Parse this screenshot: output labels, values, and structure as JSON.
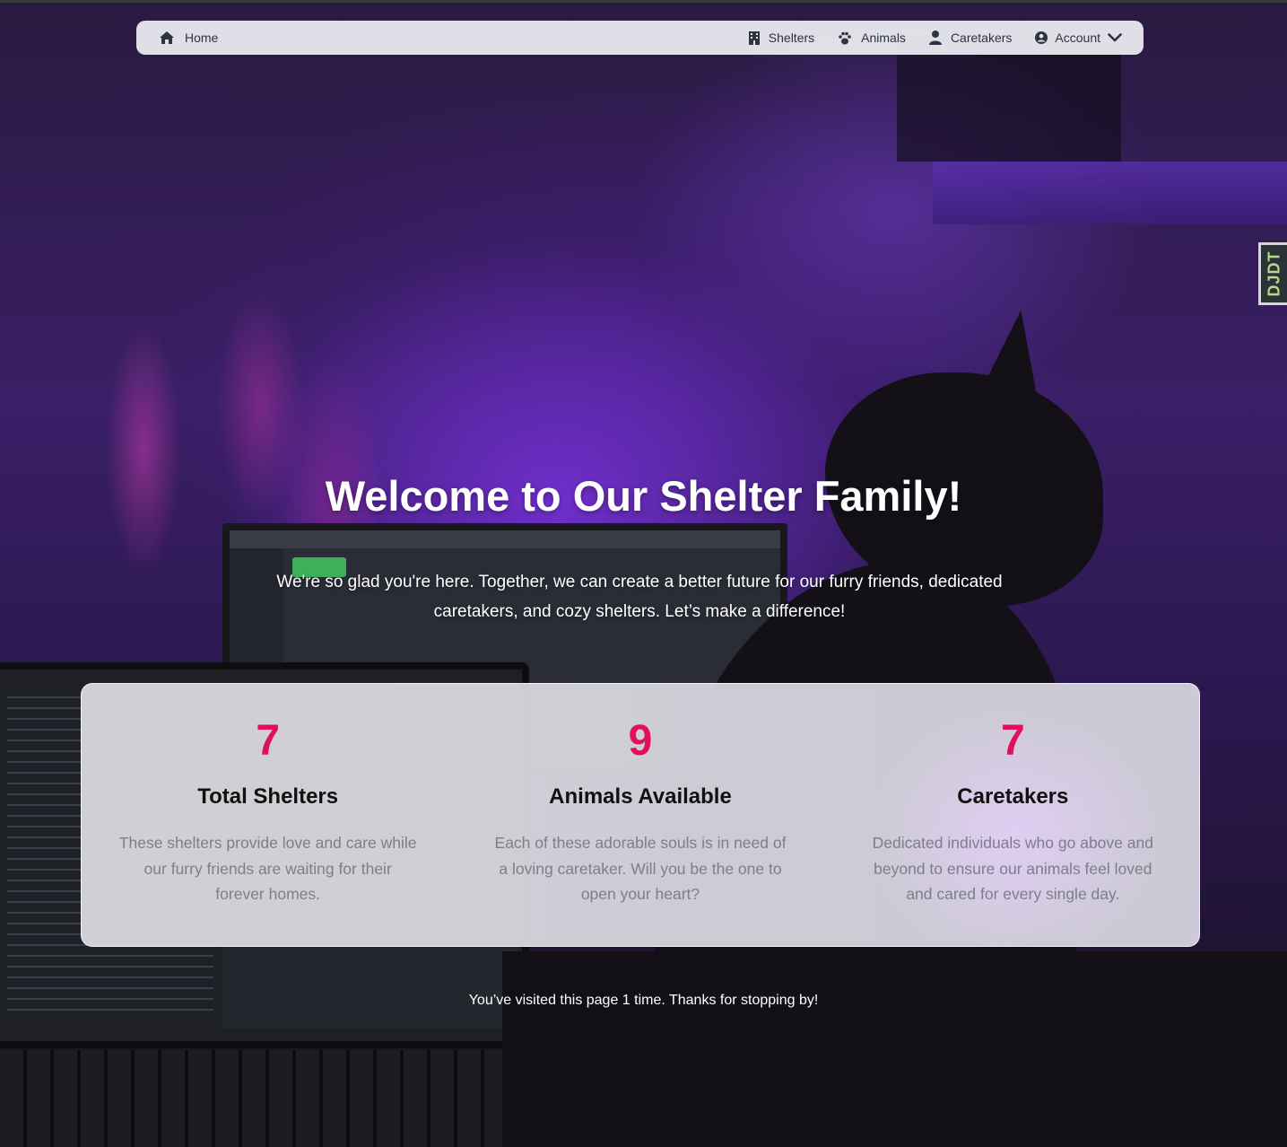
{
  "nav": {
    "home": {
      "label": "Home",
      "icon": "home-icon"
    },
    "items": [
      {
        "label": "Shelters",
        "icon": "building-icon"
      },
      {
        "label": "Animals",
        "icon": "paw-icon"
      },
      {
        "label": "Caretakers",
        "icon": "user-icon"
      },
      {
        "label": "Account",
        "icon": "user-circle-icon",
        "dropdown": "chevron-down-icon"
      }
    ]
  },
  "hero": {
    "title": "Welcome to Our Shelter Family!",
    "subtitle": "We're so glad you're here. Together, we can create a better future for our furry friends, dedicated caretakers, and cozy shelters. Let’s make a difference!"
  },
  "stats": [
    {
      "value": "7",
      "label": "Total Shelters",
      "description": "These shelters provide love and care while our furry friends are waiting for their forever homes."
    },
    {
      "value": "9",
      "label": "Animals Available",
      "description": "Each of these adorable souls is in need of a loving caretaker. Will you be the one to open your heart?"
    },
    {
      "value": "7",
      "label": "Caretakers",
      "description": "Dedicated individuals who go above and beyond to ensure our animals feel loved and cared for every single day."
    }
  ],
  "footer": {
    "visits": "You’ve visited this page 1 time. Thanks for stopping by!"
  },
  "debug_toolbar": {
    "label": "DJDT"
  },
  "colors": {
    "accent": "#e0105a",
    "nav_text": "#2d3340",
    "desc_text": "#7c7f8a"
  }
}
